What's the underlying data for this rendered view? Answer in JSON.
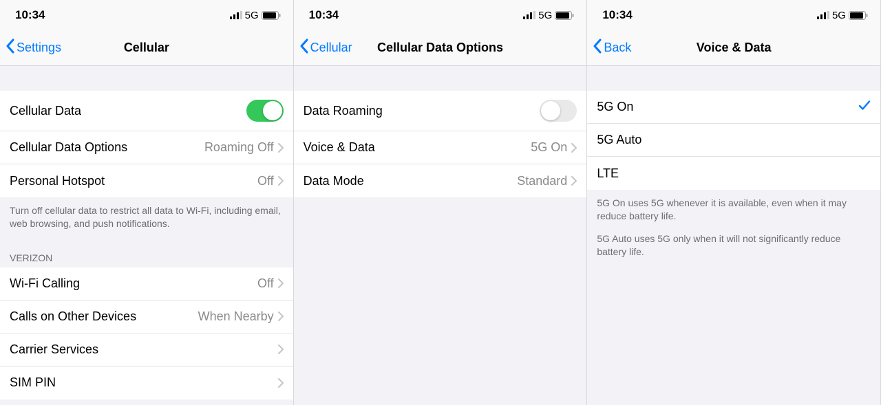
{
  "status": {
    "time": "10:34",
    "network": "5G"
  },
  "pane1": {
    "back_label": "Settings",
    "title": "Cellular",
    "rows": {
      "cellular_data": "Cellular Data",
      "cellular_data_options": "Cellular Data Options",
      "cellular_data_options_value": "Roaming Off",
      "personal_hotspot": "Personal Hotspot",
      "personal_hotspot_value": "Off"
    },
    "footer": "Turn off cellular data to restrict all data to Wi-Fi, including email, web browsing, and push notifications.",
    "section2_header": "VERIZON",
    "section2": {
      "wifi_calling": "Wi-Fi Calling",
      "wifi_calling_value": "Off",
      "calls_other": "Calls on Other Devices",
      "calls_other_value": "When Nearby",
      "carrier_services": "Carrier Services",
      "sim_pin": "SIM PIN"
    }
  },
  "pane2": {
    "back_label": "Cellular",
    "title": "Cellular Data Options",
    "rows": {
      "data_roaming": "Data Roaming",
      "voice_data": "Voice & Data",
      "voice_data_value": "5G On",
      "data_mode": "Data Mode",
      "data_mode_value": "Standard"
    }
  },
  "pane3": {
    "back_label": "Back",
    "title": "Voice & Data",
    "options": {
      "five_g_on": "5G On",
      "five_g_auto": "5G Auto",
      "lte": "LTE"
    },
    "footer1": "5G On uses 5G whenever it is available, even when it may reduce battery life.",
    "footer2": "5G Auto uses 5G only when it will not significantly reduce battery life."
  }
}
